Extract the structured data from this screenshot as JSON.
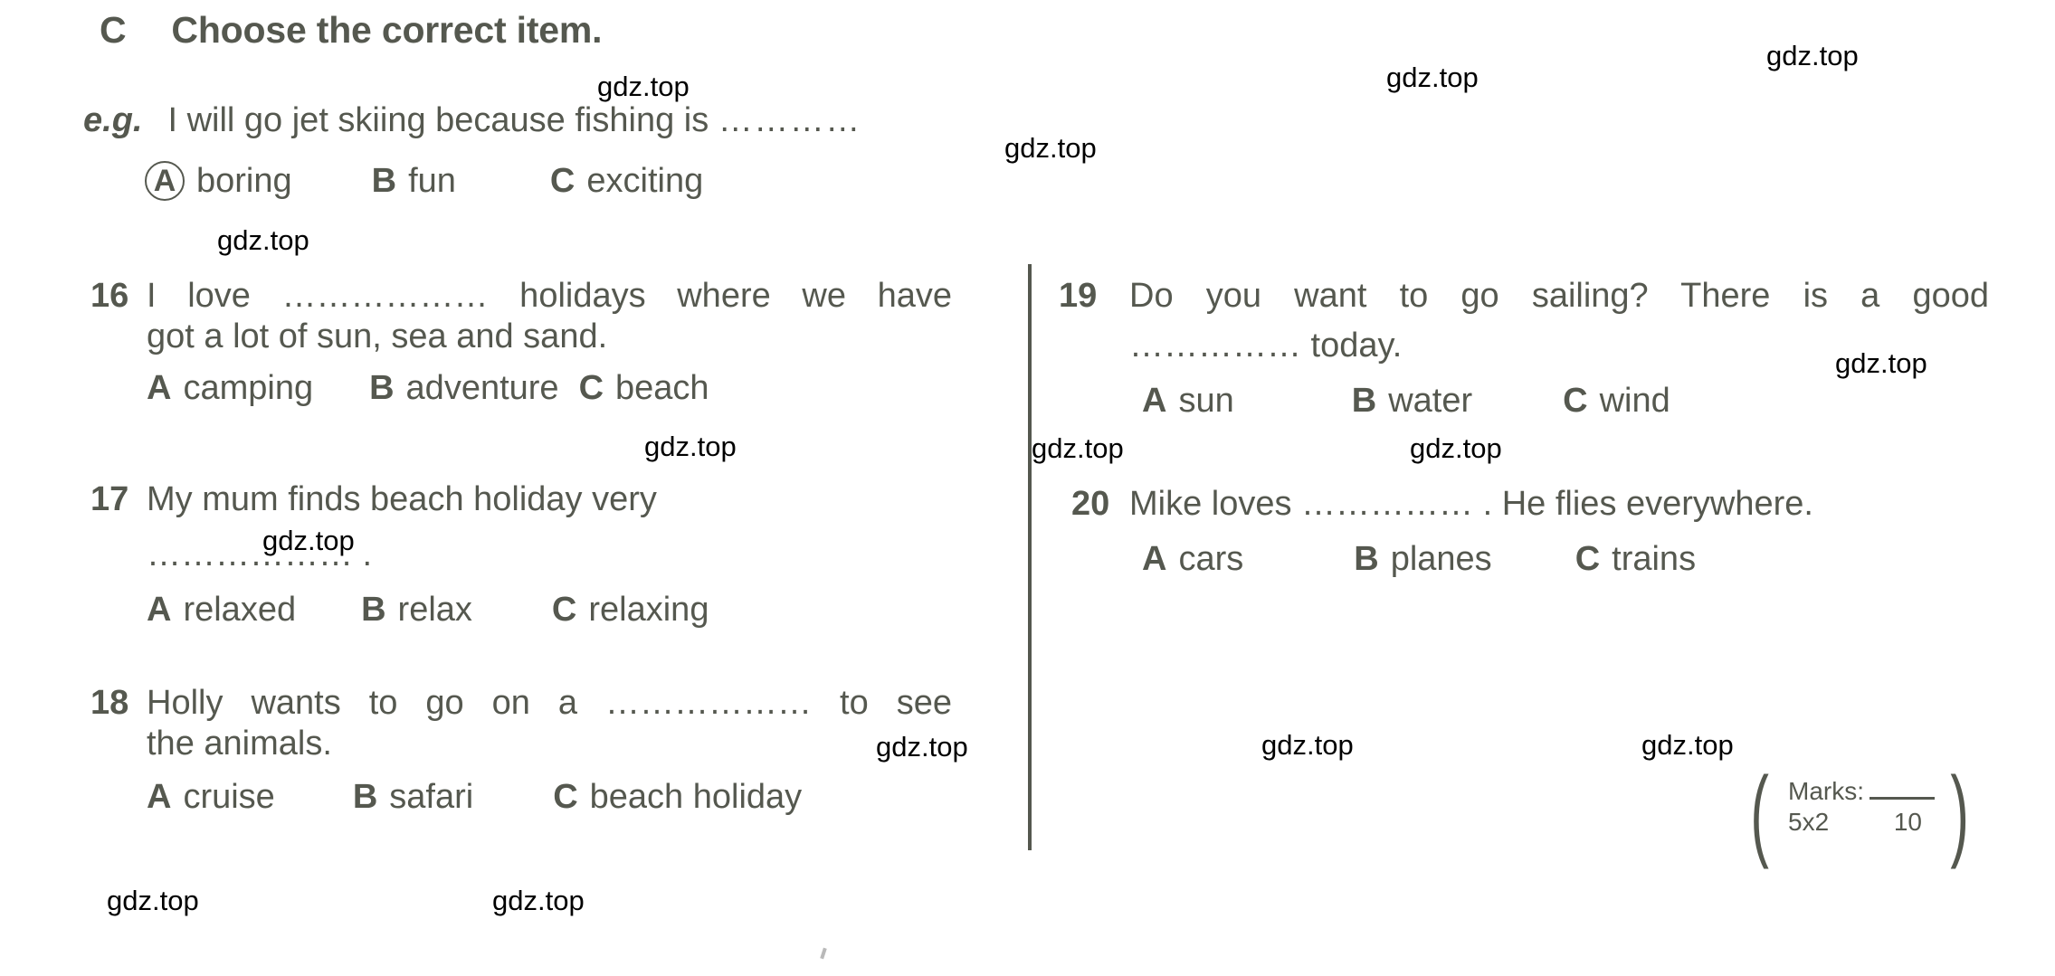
{
  "heading": {
    "letter": "C",
    "text": "Choose the correct item."
  },
  "example": {
    "label": "e.g.",
    "sentence_before": "I will go jet skiing because fishing is",
    "dots": "…………",
    "options": [
      {
        "letter": "A",
        "text": "boring",
        "circled": true
      },
      {
        "letter": "B",
        "text": "fun",
        "circled": false
      },
      {
        "letter": "C",
        "text": "exciting",
        "circled": false
      }
    ]
  },
  "questions_left": [
    {
      "number": "16",
      "lines": [
        "I love ……………… holidays where we have",
        "got a lot of sun, sea and sand."
      ],
      "options": [
        {
          "letter": "A",
          "text": "camping"
        },
        {
          "letter": "B",
          "text": "adventure"
        },
        {
          "letter": "C",
          "text": "beach"
        }
      ]
    },
    {
      "number": "17",
      "lines": [
        "My mum finds beach holiday very",
        "……………… ."
      ],
      "options": [
        {
          "letter": "A",
          "text": "relaxed"
        },
        {
          "letter": "B",
          "text": "relax"
        },
        {
          "letter": "C",
          "text": "relaxing"
        }
      ]
    },
    {
      "number": "18",
      "lines": [
        "Holly wants to go on a ……………… to see",
        "the animals."
      ],
      "options": [
        {
          "letter": "A",
          "text": "cruise"
        },
        {
          "letter": "B",
          "text": "safari"
        },
        {
          "letter": "C",
          "text": "beach holiday"
        }
      ]
    }
  ],
  "questions_right": [
    {
      "number": "19",
      "lines": [
        "Do you want to go sailing? There is a good",
        "…………… today."
      ],
      "options": [
        {
          "letter": "A",
          "text": "sun"
        },
        {
          "letter": "B",
          "text": "water"
        },
        {
          "letter": "C",
          "text": "wind"
        }
      ]
    },
    {
      "number": "20",
      "lines": [
        "Mike loves …………… . He flies everywhere."
      ],
      "options": [
        {
          "letter": "A",
          "text": "cars"
        },
        {
          "letter": "B",
          "text": "planes"
        },
        {
          "letter": "C",
          "text": "trains"
        }
      ]
    }
  ],
  "marks": {
    "label": "Marks:",
    "multiplier": "5x2",
    "total": "10"
  },
  "watermark": {
    "text": "gdz.top"
  },
  "colors": {
    "text": "#55584f",
    "watermark": "#000000",
    "divider": "#55584f"
  }
}
